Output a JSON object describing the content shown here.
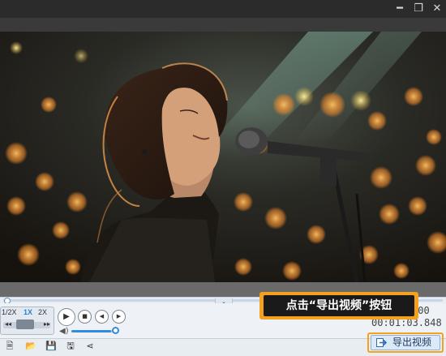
{
  "window": {
    "controls": [
      "minimize",
      "maximize",
      "close"
    ],
    "minimize_glyph": "━",
    "maximize_glyph": "❐",
    "close_glyph": "✕"
  },
  "player": {
    "speed_options": [
      "1/2X",
      "1X",
      "2X"
    ],
    "selected_speed": "1X",
    "speed_arrow_left": "◂◂",
    "speed_arrow_right": "▸▸",
    "play_glyph": "▶",
    "stop_glyph": "■",
    "prev_glyph": "◀",
    "next_glyph": "▶",
    "volume_glyph": "◀)",
    "volume_level": 0.9,
    "progress": 0.0,
    "time_total": "000",
    "time_current": "00:01:03.848",
    "collapse_glyph": "⌄"
  },
  "callout": {
    "text": "点击“导出视频”按钮"
  },
  "toolbar": {
    "icons": [
      "screenshot-icon",
      "folder-open-icon",
      "save-icon",
      "save-as-icon",
      "share-icon"
    ],
    "screenshot_glyph": "🗎",
    "folder_glyph": "📂",
    "save_glyph": "💾",
    "save_as_glyph": "🖫",
    "share_glyph": "⋖",
    "export_label": "导出视频"
  },
  "colors": {
    "accent": "#2f8be0",
    "highlight": "#f3a11e"
  }
}
